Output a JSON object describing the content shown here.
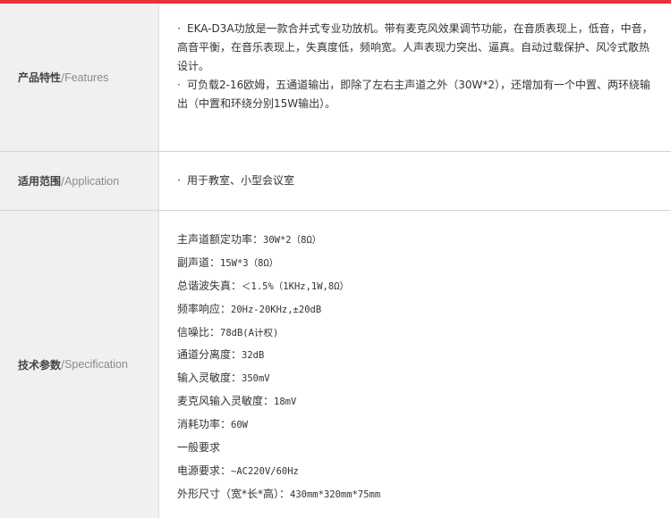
{
  "features": {
    "label_cn": "产品特性",
    "label_sep": "/",
    "label_en": "Features",
    "items": [
      "EKA-D3A功放是一款合并式专业功放机。带有麦克风效果调节功能，在音质表现上，低音，中音，高音平衡，在音乐表现上，失真度低，频响宽。人声表现力突出、逼真。自动过载保护、风冷式散热设计。",
      "可负载2-16欧姆，五通道输出，即除了左右主声道之外（30W*2），还增加有一个中置、两环绕输出（中置和环绕分别15W输出）。"
    ],
    "bullet": "·"
  },
  "application": {
    "label_cn": "适用范围",
    "label_sep": "/",
    "label_en": "Application",
    "items": [
      "用于教室、小型会议室"
    ],
    "bullet": "·"
  },
  "specification": {
    "label_cn": "技术参数",
    "label_sep": "/",
    "label_en": "Specification",
    "specs": [
      {
        "name": "主声道额定功率：",
        "value": "30W*2（8Ω）"
      },
      {
        "name": "副声道：",
        "value": "15W*3（8Ω）"
      },
      {
        "name": "总谐波失真：",
        "value": "＜1.5%（1KHz,1W,8Ω）"
      },
      {
        "name": "频率响应：",
        "value": "20Hz-20KHz,±20dB"
      },
      {
        "name": "信噪比：",
        "value": "78dB(A计权)"
      },
      {
        "name": "通道分离度：",
        "value": "32dB"
      },
      {
        "name": "输入灵敏度：",
        "value": "350mV"
      },
      {
        "name": "麦克风输入灵敏度：",
        "value": "18mV"
      },
      {
        "name": "消耗功率：",
        "value": "60W"
      },
      {
        "name": "一般要求",
        "value": ""
      },
      {
        "name": "电源要求：",
        "value": "~AC220V/60Hz"
      },
      {
        "name": "外形尺寸（宽*长*高）：",
        "value": "430mm*320mm*75mm"
      }
    ]
  }
}
